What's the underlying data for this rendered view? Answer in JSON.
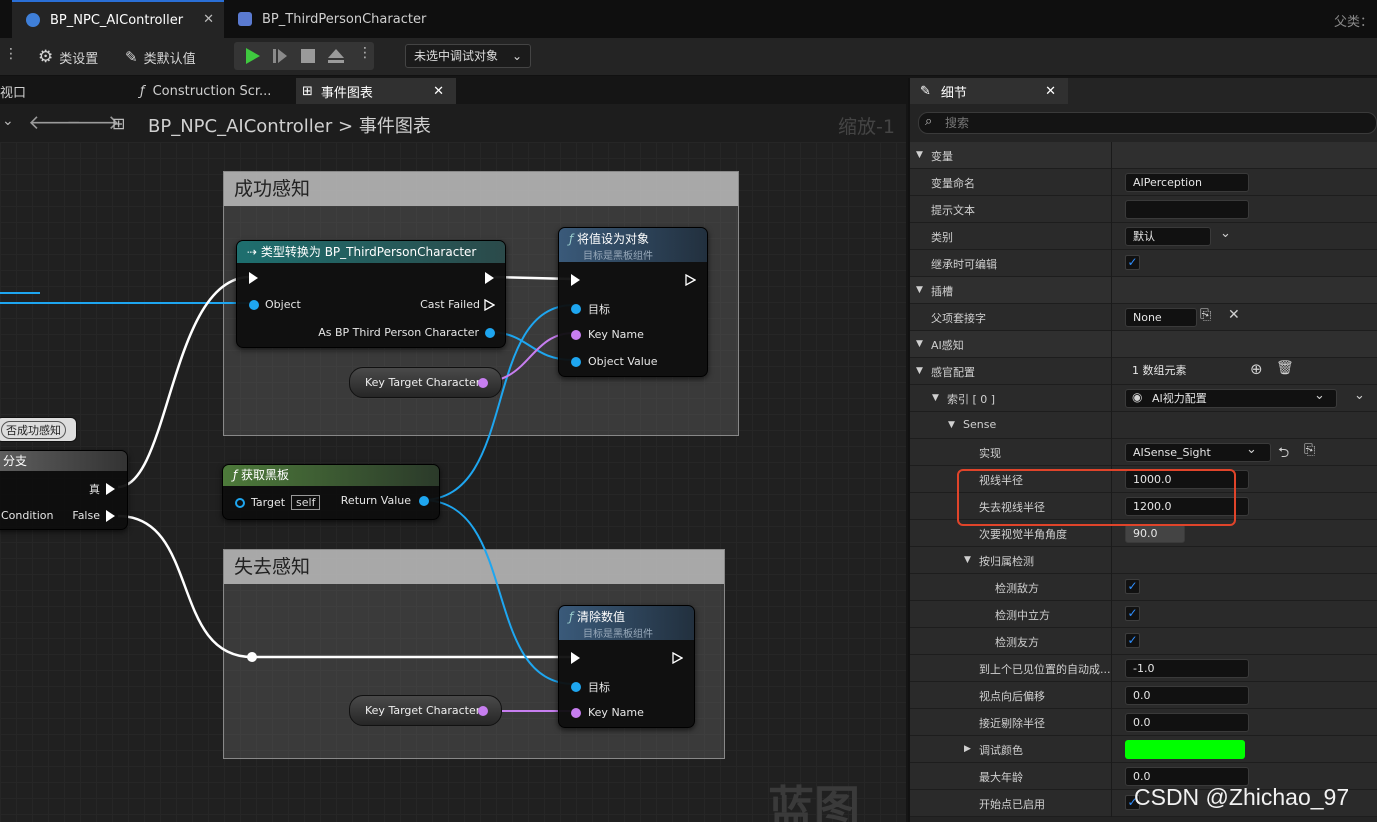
{
  "doc_tabs": [
    {
      "label": "BP_NPC_AIController"
    },
    {
      "label": "BP_ThirdPersonCharacter"
    }
  ],
  "topbar_right": "父类：",
  "toolbar": {
    "class_settings": "类设置",
    "class_defaults": "类默认值",
    "debug_target": "未选中调试对象"
  },
  "graph_tabs": [
    {
      "label": "视口"
    },
    {
      "label": "Construction Scr..."
    },
    {
      "label": "事件图表"
    }
  ],
  "breadcrumb": {
    "root": "BP_NPC_AIController",
    "sep": ">",
    "leaf": "事件图表"
  },
  "zoom": "缩放-1",
  "watermark_graph": "蓝图",
  "comments": {
    "success": "成功感知",
    "lost": "失去感知"
  },
  "nodes": {
    "cast": {
      "title": "类型转换为 BP_ThirdPersonCharacter",
      "object": "Object",
      "cast_failed": "Cast Failed",
      "as_bp": "As BP Third Person Character"
    },
    "set_value": {
      "title": "将值设为对象",
      "subtitle": "目标是黑板组件",
      "target": "目标",
      "key_name": "Key Name",
      "object_value": "Object Value"
    },
    "key_var_1": "Key Target Character",
    "get_blackboard": {
      "title": "获取黑板",
      "target": "Target",
      "self": "self",
      "return_value": "Return Value"
    },
    "clear_value": {
      "title": "清除数值",
      "subtitle": "目标是黑板组件",
      "target": "目标",
      "key_name": "Key Name"
    },
    "key_var_2": "Key Target Character",
    "branch": {
      "title": "分支",
      "true_label": "真",
      "false_label": "False",
      "condition": "Condition"
    },
    "bool_node": "否成功感知"
  },
  "details": {
    "tab": "细节",
    "search_placeholder": "搜索",
    "rows": [
      {
        "label": "变量",
        "kind": "category"
      },
      {
        "label": "变量命名",
        "value": "AIPerception"
      },
      {
        "label": "提示文本",
        "value": ""
      },
      {
        "label": "类别",
        "value": "默认"
      },
      {
        "label": "继承时可编辑",
        "check": true
      },
      {
        "label": "插槽",
        "kind": "category"
      },
      {
        "label": "父项套接字",
        "value": "None"
      },
      {
        "label": "AI感知",
        "kind": "category"
      },
      {
        "label": "感官配置",
        "value": "1 数组元素"
      },
      {
        "label": "索引 [ 0 ]",
        "value": "AI视力配置"
      },
      {
        "label": "Sense",
        "kind": "sub"
      },
      {
        "label": "实现",
        "value": "AISense_Sight"
      },
      {
        "label": "视线半径",
        "value": "1000.0"
      },
      {
        "label": "失去视线半径",
        "value": "1200.0"
      },
      {
        "label": "次要视觉半角角度",
        "value": "90.0"
      },
      {
        "label": "按归属检测",
        "kind": "sub"
      },
      {
        "label": "检测敌方",
        "check": true
      },
      {
        "label": "检测中立方",
        "check": true
      },
      {
        "label": "检测友方",
        "check": true
      },
      {
        "label": "到上个已见位置的自动成...",
        "value": "-1.0"
      },
      {
        "label": "视点向后偏移",
        "value": "0.0"
      },
      {
        "label": "接近剔除半径",
        "value": "0.0"
      },
      {
        "label": "调试颜色",
        "value": ""
      },
      {
        "label": "最大年龄",
        "value": "0.0"
      },
      {
        "label": "开始点已启用",
        "check": true
      }
    ],
    "debug_color": "#00ff00"
  },
  "watermark": "CSDN @Zhichao_97",
  "colors": {
    "highlight_box": "#e0442a",
    "accent_tab": "#2a6fd6",
    "data_wire": "#1ea6f0",
    "key_wire": "#c77ef0"
  }
}
